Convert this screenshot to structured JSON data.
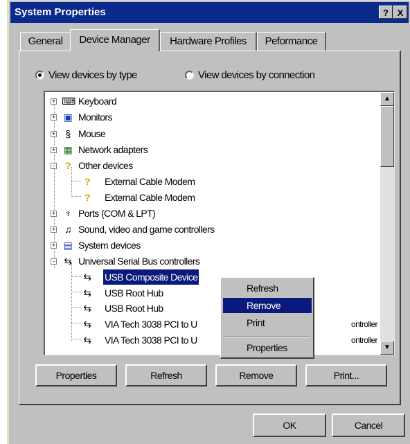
{
  "window": {
    "title": "System Properties",
    "help_label": "?",
    "close_label": "X"
  },
  "tabs": [
    {
      "label": "General",
      "active": false
    },
    {
      "label": "Device Manager",
      "active": true
    },
    {
      "label": "Hardware Profiles",
      "active": false
    },
    {
      "label": "Peformance",
      "active": false
    }
  ],
  "view_options": {
    "by_type": {
      "label": "View devices by type",
      "selected": true
    },
    "by_connection": {
      "label": "View devices by connection",
      "selected": false
    }
  },
  "tree": {
    "items": [
      {
        "label": "Keyboard",
        "icon": "keyboard-icon",
        "expander": "+"
      },
      {
        "label": "Monitors",
        "icon": "monitor-icon",
        "expander": "+"
      },
      {
        "label": "Mouse",
        "icon": "mouse-icon",
        "expander": "+"
      },
      {
        "label": "Network adapters",
        "icon": "network-adapter-icon",
        "expander": "+"
      },
      {
        "label": "Other devices",
        "icon": "unknown-device-icon",
        "expander": "-"
      },
      {
        "label": "External Cable Modem",
        "icon": "unknown-device-icon"
      },
      {
        "label": "External Cable Modem",
        "icon": "unknown-device-icon"
      },
      {
        "label": "Ports (COM & LPT)",
        "icon": "port-icon",
        "expander": "+"
      },
      {
        "label": "Sound, video and game controllers",
        "icon": "sound-icon",
        "expander": "+"
      },
      {
        "label": "System devices",
        "icon": "system-device-icon",
        "expander": "+"
      },
      {
        "label": "Universal Serial Bus controllers",
        "icon": "usb-icon",
        "expander": "-"
      },
      {
        "label": "USB Composite Device",
        "icon": "usb-icon",
        "selected": true
      },
      {
        "label": "USB Root Hub",
        "icon": "usb-icon"
      },
      {
        "label": "USB Root Hub",
        "icon": "usb-icon"
      },
      {
        "label": "VIA Tech 3038 PCI to U",
        "suffix": "ontroller",
        "icon": "usb-icon"
      },
      {
        "label": "VIA Tech 3038 PCI to U",
        "suffix": "ontroller",
        "icon": "usb-icon"
      }
    ]
  },
  "context_menu": {
    "items": [
      {
        "label": "Refresh",
        "highlighted": false
      },
      {
        "label": "Remove",
        "highlighted": true
      },
      {
        "label": "Print",
        "highlighted": false
      },
      {
        "label": "Properties",
        "highlighted": false
      }
    ]
  },
  "panel_buttons": {
    "properties": "Properties",
    "refresh": "Refresh",
    "remove": "Remove",
    "print": "Print..."
  },
  "dialog_buttons": {
    "ok": "OK",
    "cancel": "Cancel"
  },
  "colors": {
    "titlebar": "#0a2a8c",
    "selection": "#0a1a7c",
    "face": "#c0c0c0"
  }
}
